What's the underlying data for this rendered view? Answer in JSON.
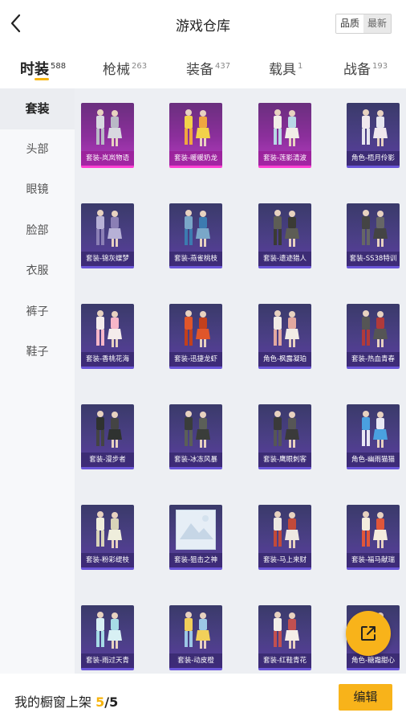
{
  "header": {
    "title": "游戏仓库",
    "sort_options": [
      "品质",
      "最新"
    ],
    "back_icon": "chevron-left-icon"
  },
  "tabs": [
    {
      "label": "时装",
      "count": "588",
      "active": true
    },
    {
      "label": "枪械",
      "count": "263",
      "active": false
    },
    {
      "label": "装备",
      "count": "437",
      "active": false
    },
    {
      "label": "载具",
      "count": "1",
      "active": false
    },
    {
      "label": "战备",
      "count": "193",
      "active": false
    }
  ],
  "sidebar": {
    "items": [
      "套装",
      "头部",
      "眼镜",
      "脸部",
      "衣服",
      "裤子",
      "鞋子"
    ],
    "active": "套装"
  },
  "items": [
    {
      "label": "套装-岚岚物语",
      "rarity": "legendary"
    },
    {
      "label": "套装-暖暖奶龙",
      "rarity": "legendary"
    },
    {
      "label": "套装-莲影清波",
      "rarity": "legendary"
    },
    {
      "label": "角色-梧月伶影",
      "rarity": "epic"
    },
    {
      "label": "套装-锦灰蝶梦",
      "rarity": "epic"
    },
    {
      "label": "套装-燕雀桃枝",
      "rarity": "epic"
    },
    {
      "label": "套装-遗迹猎人",
      "rarity": "epic"
    },
    {
      "label": "套装-SS38特训",
      "rarity": "epic"
    },
    {
      "label": "套装-香桃花海",
      "rarity": "epic"
    },
    {
      "label": "套装-迅捷龙虾",
      "rarity": "epic"
    },
    {
      "label": "角色-枫露凝珀",
      "rarity": "epic"
    },
    {
      "label": "套装-热血青春",
      "rarity": "epic"
    },
    {
      "label": "套装-漫步者",
      "rarity": "epic"
    },
    {
      "label": "套装-冰冻风暴",
      "rarity": "epic"
    },
    {
      "label": "套装-鹰眼刺客",
      "rarity": "epic"
    },
    {
      "label": "角色-幽雨猫猫",
      "rarity": "epic"
    },
    {
      "label": "套装-粉彩缇枝",
      "rarity": "epic"
    },
    {
      "label": "套装-狙击之神",
      "rarity": "epic",
      "placeholder": true
    },
    {
      "label": "套装-马上来财",
      "rarity": "epic"
    },
    {
      "label": "套装-福马献瑞",
      "rarity": "epic"
    },
    {
      "label": "套装-雨过天青",
      "rarity": "epic"
    },
    {
      "label": "套装-动皮橙",
      "rarity": "epic"
    },
    {
      "label": "套装-红鞋青花",
      "rarity": "epic"
    },
    {
      "label": "角色-糖霜甜心",
      "rarity": "epic"
    }
  ],
  "fab": {
    "icon": "share-export-icon"
  },
  "footer": {
    "prefix": "我的橱窗上架",
    "current": "5",
    "separator": "/",
    "total": "5",
    "edit_label": "编辑"
  },
  "colors": {
    "accent": "#f8b31a",
    "legendary_border": "#ff3fd2",
    "epic_border": "#6a56d8"
  }
}
